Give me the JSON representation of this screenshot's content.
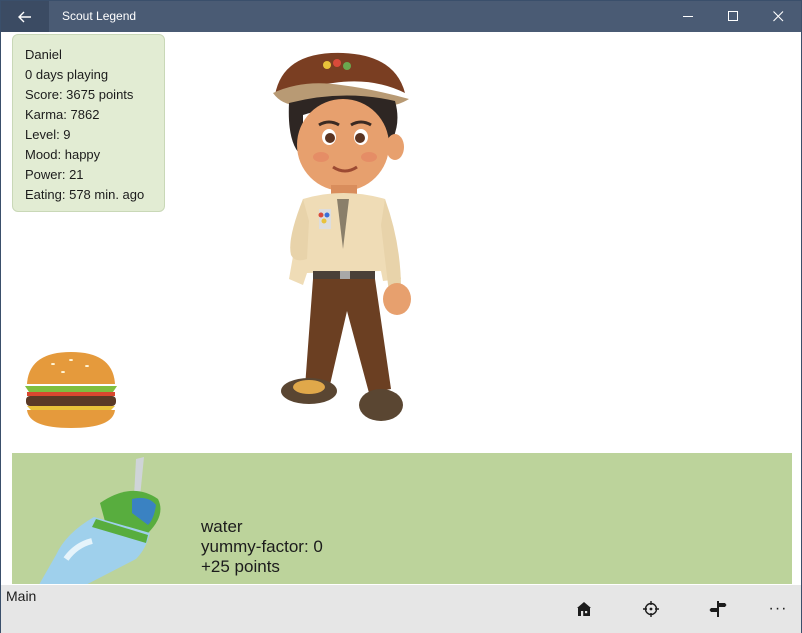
{
  "window": {
    "title": "Scout Legend",
    "titlebar_color": "#4a5b74"
  },
  "stats": {
    "name": "Daniel",
    "days": "0 days playing",
    "score": "Score: 3675 points",
    "karma": "Karma: 7862",
    "level": "Level: 9",
    "mood": "Mood: happy",
    "power": "Power: 21",
    "eating": "Eating: 578 min. ago"
  },
  "drink": {
    "name": "water",
    "yummy": "yummy-factor: 0",
    "points": "+25 points",
    "panel_color": "#bcd39b"
  },
  "appbar": {
    "label": "Main",
    "buttons": [
      "home-icon",
      "target-icon",
      "signpost-icon",
      "more-icon"
    ],
    "more": "···"
  }
}
